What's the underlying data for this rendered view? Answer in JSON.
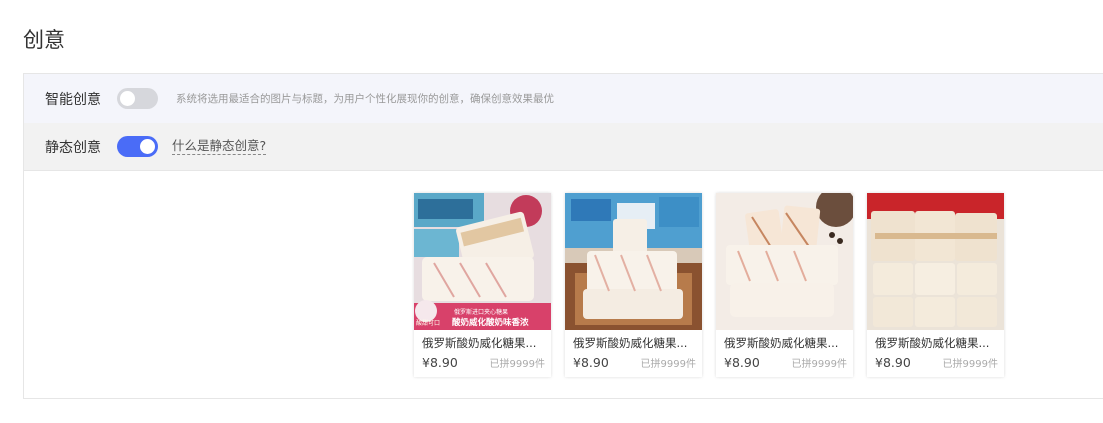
{
  "page": {
    "title": "创意"
  },
  "smart": {
    "label": "智能创意",
    "enabled": false,
    "hint": "系统将选用最适合的图片与标题，为用户个性化展现你的创意，确保创意效果最优"
  },
  "static": {
    "label": "静态创意",
    "enabled": true,
    "link": "什么是静态创意?"
  },
  "products": [
    {
      "name": "俄罗斯酸奶威化糖果...",
      "price": "¥8.90",
      "sold": "已拼9999件",
      "image_text_top": "俄罗斯进口夹心糖果",
      "image_text_main": "酸奶威化酸奶味香浓",
      "image_text_badge": "酸甜可口"
    },
    {
      "name": "俄罗斯酸奶威化糖果...",
      "price": "¥8.90",
      "sold": "已拼9999件"
    },
    {
      "name": "俄罗斯酸奶威化糖果...",
      "price": "¥8.90",
      "sold": "已拼9999件"
    },
    {
      "name": "俄罗斯酸奶威化糖果...",
      "price": "¥8.90",
      "sold": "已拼9999件"
    }
  ],
  "colors": {
    "accent": "#4a6cf7",
    "toggle_off": "#d6d7dc",
    "smart_row_bg": "#f4f5fb",
    "static_row_bg": "#f2f2f2"
  }
}
